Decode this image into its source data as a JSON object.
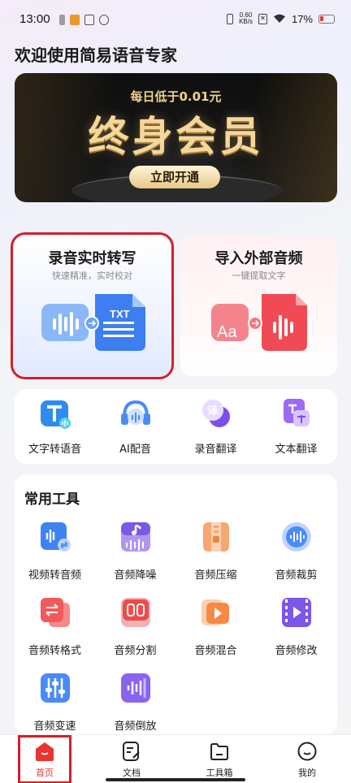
{
  "status_bar": {
    "time": "13:00",
    "speed_value": "0.60",
    "speed_unit": "KB/s",
    "battery": "17%"
  },
  "page": {
    "title": "欢迎使用简易语音专家"
  },
  "banner": {
    "subtitle": "每日低于0.01元",
    "headline": "终身会员",
    "button_label": "立即开通"
  },
  "feature_cards": [
    {
      "title": "录音实时转写",
      "subtitle": "快速精准，实时校对",
      "file_tag": "TXT"
    },
    {
      "title": "导入外部音频",
      "subtitle": "一键提取文字",
      "icon_text": "Aa"
    }
  ],
  "quick_actions": [
    {
      "label": "文字转语音",
      "icon": "text-to-speech-icon"
    },
    {
      "label": "AI配音",
      "icon": "ai-dubbing-icon"
    },
    {
      "label": "录音翻译",
      "icon": "recording-translate-icon"
    },
    {
      "label": "文本翻译",
      "icon": "text-translate-icon"
    }
  ],
  "tools": {
    "title": "常用工具",
    "items": [
      {
        "label": "视频转音频",
        "icon": "video-to-audio-icon"
      },
      {
        "label": "音频降噪",
        "icon": "audio-denoise-icon"
      },
      {
        "label": "音频压缩",
        "icon": "audio-compress-icon"
      },
      {
        "label": "音频裁剪",
        "icon": "audio-trim-icon"
      },
      {
        "label": "音频转格式",
        "icon": "audio-convert-icon"
      },
      {
        "label": "音频分割",
        "icon": "audio-split-icon"
      },
      {
        "label": "音频混合",
        "icon": "audio-mix-icon"
      },
      {
        "label": "音频修改",
        "icon": "audio-edit-icon"
      },
      {
        "label": "音频变速",
        "icon": "audio-speed-icon"
      },
      {
        "label": "音频倒放",
        "icon": "audio-reverse-icon"
      }
    ]
  },
  "tabbar": {
    "items": [
      {
        "label": "首页",
        "icon": "home-icon",
        "active": true
      },
      {
        "label": "文档",
        "icon": "document-icon",
        "active": false
      },
      {
        "label": "工具箱",
        "icon": "toolbox-icon",
        "active": false
      },
      {
        "label": "我的",
        "icon": "profile-icon",
        "active": false
      }
    ]
  },
  "colors": {
    "accent": "#e8352f",
    "highlight_outline": "#d81e2a",
    "blue": "#4a8cf7",
    "red": "#f04a55",
    "gold": "#f4d79a"
  }
}
